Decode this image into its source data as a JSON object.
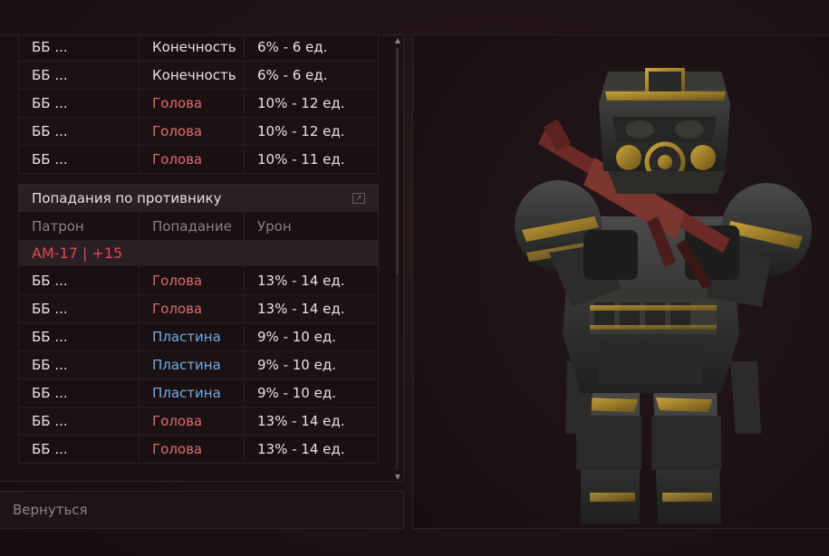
{
  "top_table": {
    "rows": [
      {
        "ammo": "ББ ...",
        "zone": "Конечность",
        "zone_type": "limb",
        "damage": "6% - 6 ед."
      },
      {
        "ammo": "ББ ...",
        "zone": "Конечность",
        "zone_type": "limb",
        "damage": "6% - 6 ед."
      },
      {
        "ammo": "ББ ...",
        "zone": "Голова",
        "zone_type": "head",
        "damage": "10% - 12 ед."
      },
      {
        "ammo": "ББ ...",
        "zone": "Голова",
        "zone_type": "head",
        "damage": "10% - 12 ед."
      },
      {
        "ammo": "ББ ...",
        "zone": "Голова",
        "zone_type": "head",
        "damage": "10% - 11 ед."
      }
    ]
  },
  "enemy_hits": {
    "title": "Попадания по противнику",
    "columns": [
      "Патрон",
      "Попадание",
      "Урон"
    ],
    "weapon": "АМ-17 | +15",
    "rows": [
      {
        "ammo": "ББ ...",
        "zone": "Голова",
        "zone_type": "head",
        "damage": "13% - 14 ед."
      },
      {
        "ammo": "ББ ...",
        "zone": "Голова",
        "zone_type": "head",
        "damage": "13% - 14 ед."
      },
      {
        "ammo": "ББ ...",
        "zone": "Пластина",
        "zone_type": "plate",
        "damage": "9% - 10 ед."
      },
      {
        "ammo": "ББ ...",
        "zone": "Пластина",
        "zone_type": "plate",
        "damage": "9% - 10 ед."
      },
      {
        "ammo": "ББ ...",
        "zone": "Пластина",
        "zone_type": "plate",
        "damage": "9% - 10 ед."
      },
      {
        "ammo": "ББ ...",
        "zone": "Голова",
        "zone_type": "head",
        "damage": "13% - 14 ед."
      },
      {
        "ammo": "ББ ...",
        "zone": "Голова",
        "zone_type": "head",
        "damage": "13% - 14 ед."
      }
    ]
  },
  "back_button": {
    "label": "Вернуться"
  },
  "colors": {
    "head": "#e06a6a",
    "limb": "#e8e3e3",
    "plate": "#6faee8",
    "weapon": "#e24a52"
  },
  "icons": {
    "expand": "expand-icon",
    "scroll_up": "arrow-up-icon",
    "scroll_down": "arrow-down-icon"
  },
  "viewer": {
    "subject": "armored-soldier-with-rifle"
  }
}
